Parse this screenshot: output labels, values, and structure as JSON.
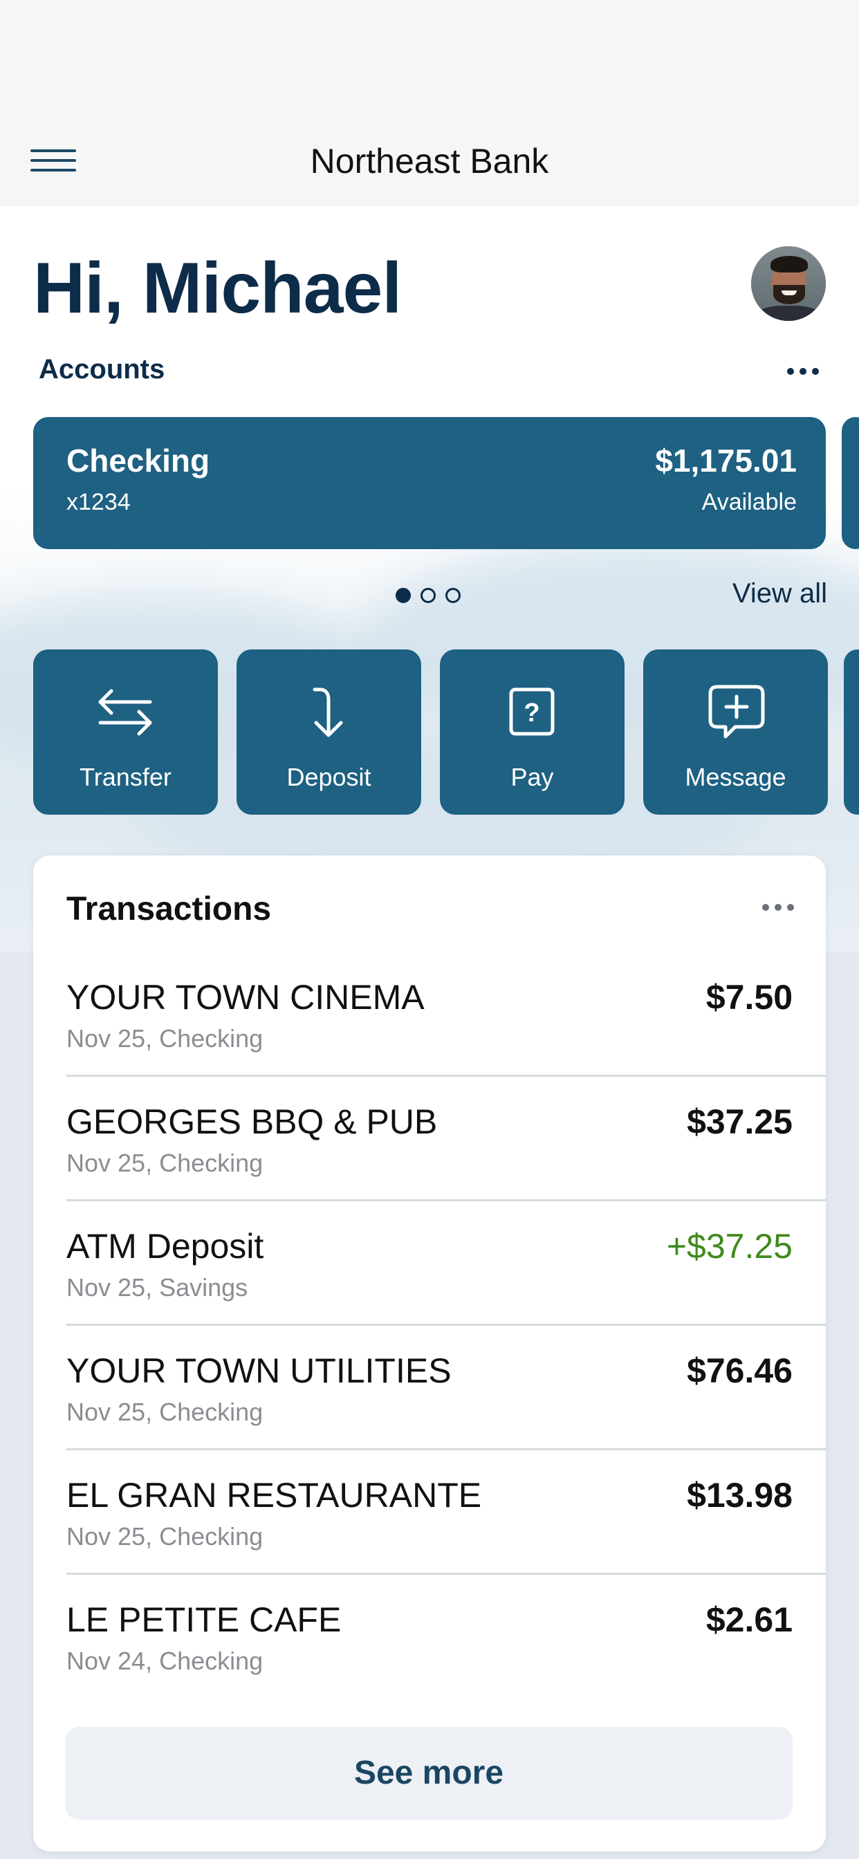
{
  "header": {
    "title": "Northeast Bank",
    "menu_icon": "hamburger-menu-icon"
  },
  "greeting": {
    "text": "Hi, Michael",
    "avatar": "profile-avatar"
  },
  "accounts": {
    "label": "Accounts",
    "more_icon": "more-options-icon",
    "cards": [
      {
        "name": "Checking",
        "number": "x1234",
        "balance": "$1,175.01",
        "balance_label": "Available"
      }
    ],
    "pager": {
      "count": 3,
      "active_index": 0
    },
    "view_all": "View all"
  },
  "actions": [
    {
      "label": "Transfer",
      "icon": "transfer-arrows-icon"
    },
    {
      "label": "Deposit",
      "icon": "deposit-arrow-icon"
    },
    {
      "label": "Pay",
      "icon": "pay-question-icon"
    },
    {
      "label": "Message",
      "icon": "message-plus-icon"
    }
  ],
  "transactions": {
    "title": "Transactions",
    "more_icon": "more-options-icon",
    "items": [
      {
        "merchant": "YOUR TOWN CINEMA",
        "meta": "Nov 25, Checking",
        "amount": "$7.50",
        "type": "debit"
      },
      {
        "merchant": "GEORGES BBQ & PUB",
        "meta": "Nov 25, Checking",
        "amount": "$37.25",
        "type": "debit"
      },
      {
        "merchant": "ATM Deposit",
        "meta": "Nov 25, Savings",
        "amount": "+$37.25",
        "type": "credit"
      },
      {
        "merchant": "YOUR TOWN UTILITIES",
        "meta": "Nov 25, Checking",
        "amount": "$76.46",
        "type": "debit"
      },
      {
        "merchant": "EL GRAN RESTAURANTE",
        "meta": "Nov 25, Checking",
        "amount": "$13.98",
        "type": "debit"
      },
      {
        "merchant": "LE PETITE CAFE",
        "meta": "Nov 24, Checking",
        "amount": "$2.61",
        "type": "debit"
      }
    ],
    "see_more": "See more"
  },
  "colors": {
    "brand_navy": "#0d2c4a",
    "card_blue": "#1e6182",
    "credit_green": "#3f8a1c",
    "muted_text": "#8a8d92"
  }
}
